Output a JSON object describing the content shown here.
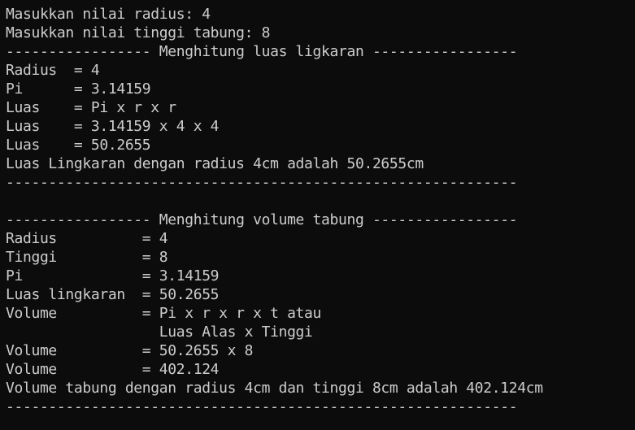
{
  "terminal": {
    "lines": [
      "Masukkan nilai radius: 4",
      "Masukkan nilai tinggi tabung: 8",
      "----------------- Menghitung luas ligkaran -----------------",
      "Radius  = 4",
      "Pi      = 3.14159",
      "Luas    = Pi x r x r",
      "Luas    = 3.14159 x 4 x 4",
      "Luas    = 50.2655",
      "Luas Lingkaran dengan radius 4cm adalah 50.2655cm",
      "------------------------------------------------------------",
      "",
      "----------------- Menghitung volume tabung -----------------",
      "Radius          = 4",
      "Tinggi          = 8",
      "Pi              = 3.14159",
      "Luas lingkaran  = 50.2655",
      "Volume          = Pi x r x r x t atau",
      "                  Luas Alas x Tinggi",
      "Volume          = 50.2655 x 8",
      "Volume          = 402.124",
      "Volume tabung dengan radius 4cm dan tinggi 8cm adalah 402.124cm",
      "------------------------------------------------------------"
    ]
  },
  "colors": {
    "background": "#0c0c0c",
    "text": "#cccccc"
  }
}
